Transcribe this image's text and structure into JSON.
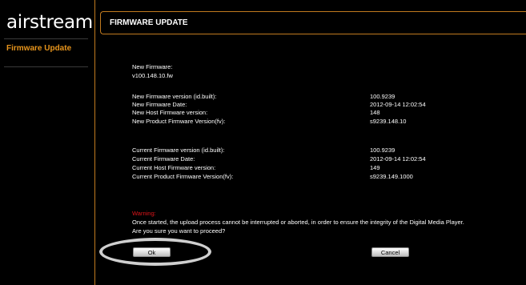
{
  "sidebar": {
    "logo": "airstream",
    "items": [
      {
        "label": "Firmware Update"
      }
    ]
  },
  "header": {
    "title": "FIRMWARE UPDATE"
  },
  "new_firmware": {
    "label": "New Firmware:",
    "file": "v100.148.10.fw",
    "rows": [
      {
        "label": "New Firmware version (id.built):",
        "value": "100.9239"
      },
      {
        "label": "New Firmware Date:",
        "value": "2012-09-14  12:02:54"
      },
      {
        "label": "New Host Firmware version:",
        "value": "148"
      },
      {
        "label": "New Product Firmware Version(fv):",
        "value": "s9239.148.10"
      }
    ]
  },
  "current_firmware": {
    "rows": [
      {
        "label": "Current Firmware version (id.built):",
        "value": "100.9239"
      },
      {
        "label": "Current Firmware Date:",
        "value": "2012-09-14  12:02:54"
      },
      {
        "label": "Current Host Firmware version:",
        "value": "149"
      },
      {
        "label": "Current Product Firmware Version(fv):",
        "value": "s9239.149.1000"
      }
    ]
  },
  "warning": {
    "title": "Warning:",
    "message": "Once started, the upload process cannot be interrupted or aborted, in order to ensure the integrity of the Digital Media Player.",
    "question": "Are you sure you want to proceed?"
  },
  "buttons": {
    "ok": "Ok",
    "cancel": "Cancel"
  },
  "colors": {
    "accent": "#c07a1f",
    "sidebar_item": "#e8951c",
    "warning": "#e0151a",
    "background": "#000000"
  }
}
